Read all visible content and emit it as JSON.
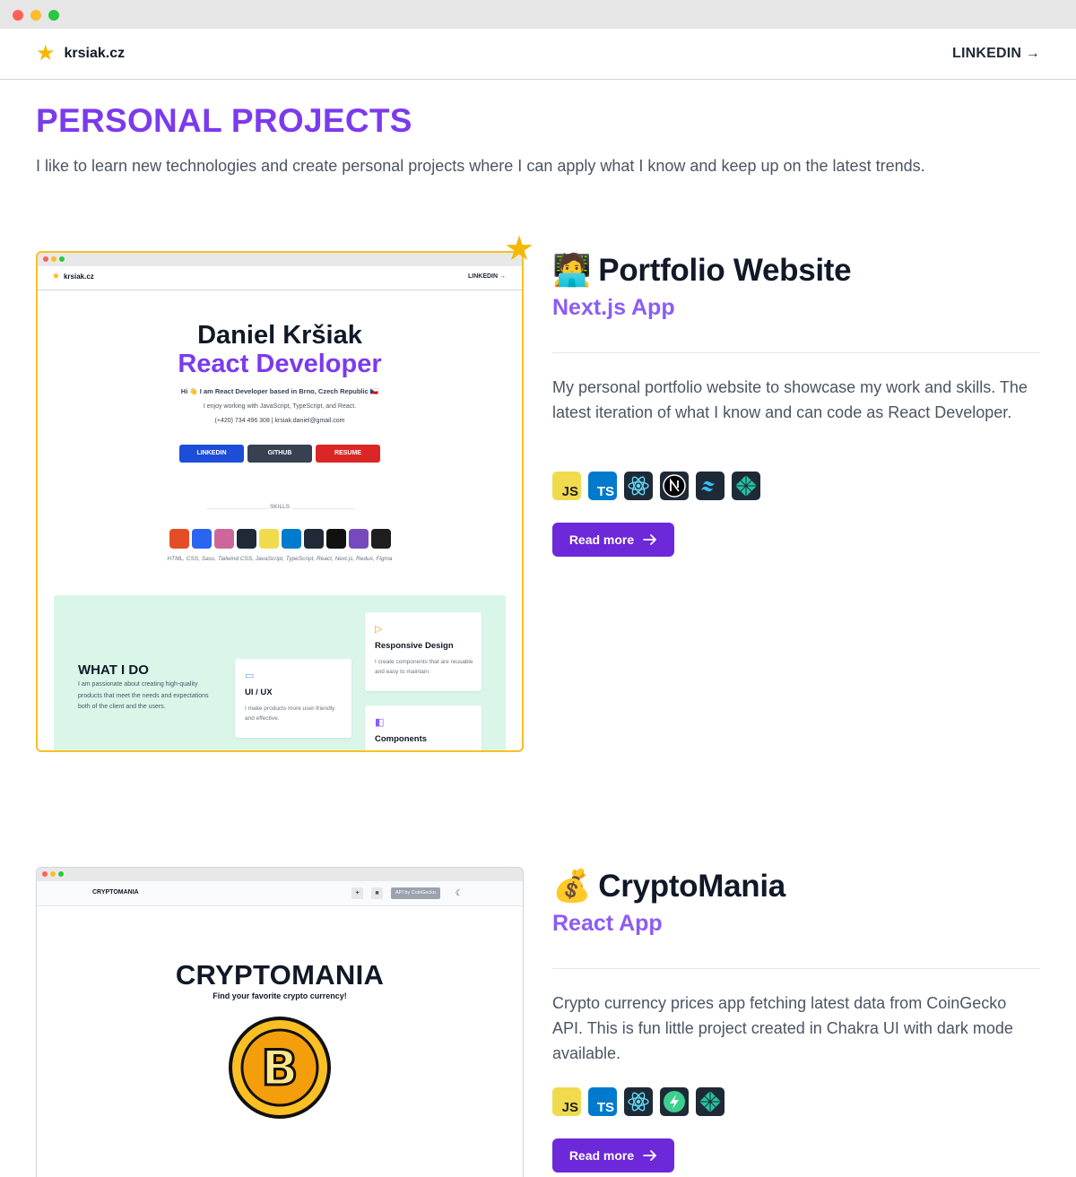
{
  "window": {
    "controls": [
      "close",
      "minimize",
      "maximize"
    ]
  },
  "nav": {
    "logo_icon": "star-icon",
    "site_name": "krsiak.cz",
    "link_label": "LINKEDIN →"
  },
  "page": {
    "title": "PERSONAL PROJECTS",
    "intro": "I like to learn new technologies and create personal projects where I can apply what I know and keep up on the latest trends."
  },
  "projects": [
    {
      "emoji": "🧑‍💻",
      "title": "Portfolio Website",
      "type": "Next.js App",
      "description": "My personal portfolio website to showcase my work and skills. The latest iteration of what I know and can code as React Developer.",
      "featured_icon": "star-icon",
      "tech": [
        "javascript-icon",
        "typescript-icon",
        "react-icon",
        "nextjs-icon",
        "tailwind-icon",
        "netlify-icon"
      ],
      "read_more": "Read more",
      "preview": {
        "site_name": "krsiak.cz",
        "nav_link": "LINKEDIN →",
        "name": "Daniel Kršiak",
        "role": "React Developer",
        "hi_text": "Hi 👋 I am React Developer based in Brno, Czech Republic 🇨🇿",
        "enjoy_text": "I enjoy working with JavaScript, TypeScript, and React.",
        "contact_text": "(+420) 734 496 308 | krsiak.daniel@gmail.com",
        "buttons": [
          "LINKEDIN",
          "GITHUB",
          "RESUME"
        ],
        "skills_label": "SKILLS",
        "skills_list": "HTML, CSS, Sass, Tailwind CSS, JavaScript, TypeScript, React, Next.js, Redux, Figma",
        "what_i_do_title": "WHAT I DO",
        "what_i_do_text": "I am passionate about creating high-quality products that meet the needs and expectations both of the client and the users.",
        "cards": [
          {
            "title": "UI / UX",
            "text": "I make products more user-friendly and effective."
          },
          {
            "title": "Responsive Design",
            "text": "I create components that are reusable and easy to maintain."
          },
          {
            "title": "Components",
            "text": ""
          }
        ]
      }
    },
    {
      "emoji": "💰",
      "title": "CryptoMania",
      "type": "React App",
      "description": "Crypto currency prices app fetching latest data from CoinGecko API. This is fun little project created in Chakra UI with dark mode available.",
      "tech": [
        "javascript-icon",
        "typescript-icon",
        "react-icon",
        "supabase-icon",
        "netlify-icon"
      ],
      "read_more": "Read more",
      "preview": {
        "logo": "CRYPTOMANIA",
        "api_badge": "API by CoinGecko",
        "title": "CRYPTOMANIA",
        "subtitle": "Find your favorite crypto currency!",
        "coin_letter": "B"
      }
    }
  ]
}
